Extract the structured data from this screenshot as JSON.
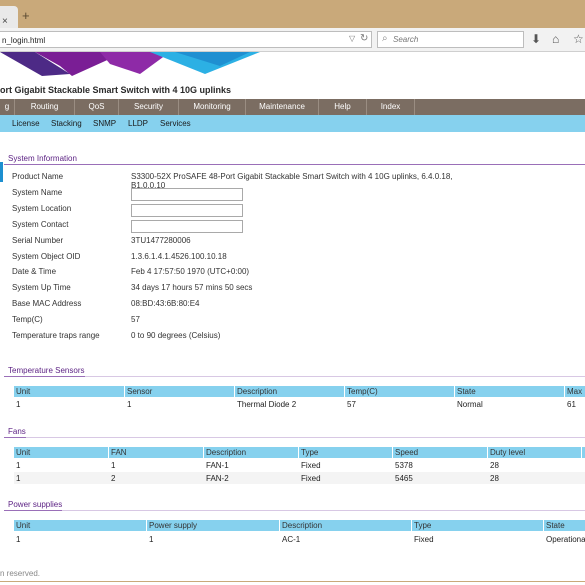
{
  "browser": {
    "url": "n_login.html",
    "search_placeholder": "Search",
    "new_tab": "+",
    "tab_close": "×"
  },
  "header": {
    "title": "ort Gigabit Stackable Smart Switch with 4 10G uplinks"
  },
  "main_menu": [
    "g",
    "Routing",
    "QoS",
    "Security",
    "Monitoring",
    "Maintenance",
    "Help",
    "Index"
  ],
  "sub_menu": [
    "License",
    "Stacking",
    "SNMP",
    "LLDP",
    "Services"
  ],
  "system_info": {
    "section_title": "System Information",
    "rows": [
      {
        "label": "Product Name",
        "value": "S3300-52X ProSAFE 48-Port Gigabit Stackable Smart Switch with 4 10G uplinks, 6.4.0.18,",
        "value2": "B1.0.0.10"
      },
      {
        "label": "System Name",
        "input": ""
      },
      {
        "label": "System Location",
        "input": ""
      },
      {
        "label": "System Contact",
        "input": ""
      },
      {
        "label": "Serial Number",
        "value": "3TU1477280006"
      },
      {
        "label": "System Object OID",
        "value": "1.3.6.1.4.1.4526.100.10.18"
      },
      {
        "label": "Date & Time",
        "value": "Feb 4 17:57:50 1970 (UTC+0:00)"
      },
      {
        "label": "System Up Time",
        "value": "34 days 17 hours 57 mins 50 secs"
      },
      {
        "label": "Base MAC Address",
        "value": "08:BD:43:6B:80:E4"
      },
      {
        "label": "Temp(C)",
        "value": "57"
      },
      {
        "label": "Temperature traps range",
        "value": "0 to 90 degrees (Celsius)"
      }
    ]
  },
  "temperature": {
    "section_title": "Temperature Sensors",
    "headers": [
      "Unit",
      "Sensor",
      "Description",
      "Temp(C)",
      "State",
      "Max"
    ],
    "rows": [
      [
        "1",
        "1",
        "Thermal Diode 2",
        "57",
        "Normal",
        "61"
      ]
    ]
  },
  "fans": {
    "section_title": "Fans",
    "headers": [
      "Unit",
      "FAN",
      "Description",
      "Type",
      "Speed",
      "Duty level"
    ],
    "rows": [
      [
        "1",
        "1",
        "FAN-1",
        "Fixed",
        "5378",
        "28"
      ],
      [
        "1",
        "2",
        "FAN-2",
        "Fixed",
        "5465",
        "28"
      ]
    ]
  },
  "power": {
    "section_title": "Power supplies",
    "headers": [
      "Unit",
      "Power supply",
      "Description",
      "Type",
      "State"
    ],
    "rows": [
      [
        "1",
        "1",
        "AC-1",
        "Fixed",
        "Operational"
      ]
    ]
  },
  "footer": {
    "text": "n reserved."
  }
}
